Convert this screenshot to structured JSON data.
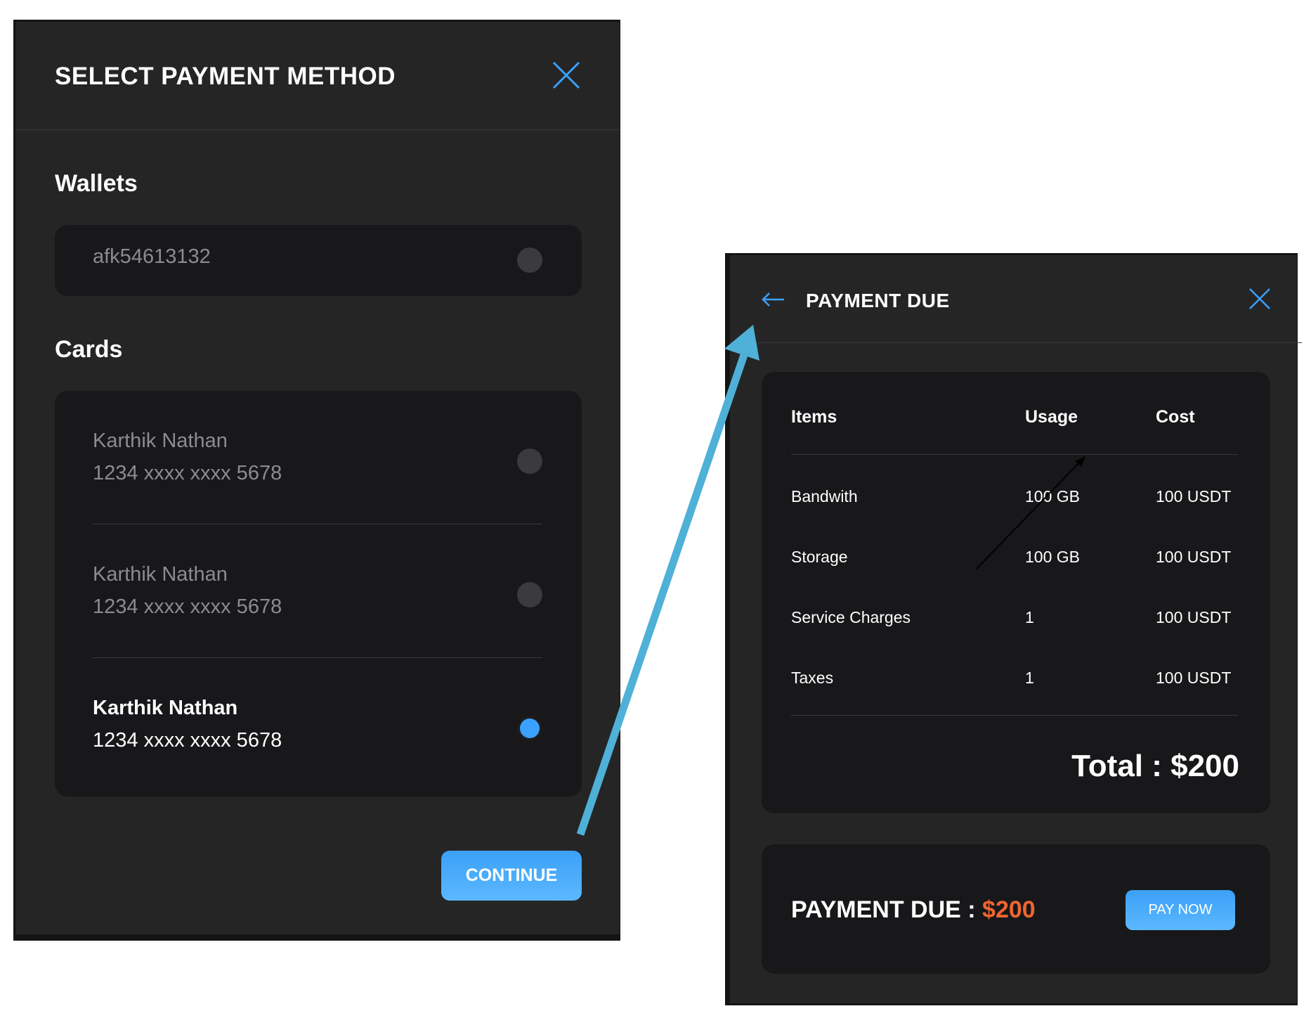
{
  "left": {
    "title": "SELECT PAYMENT METHOD",
    "wallets_heading": "Wallets",
    "wallet": {
      "id": "afk54613132",
      "selected": false
    },
    "cards_heading": "Cards",
    "cards": [
      {
        "name": "Karthik Nathan",
        "number": "1234 xxxx xxxx 5678",
        "selected": false
      },
      {
        "name": "Karthik Nathan",
        "number": "1234 xxxx xxxx 5678",
        "selected": false
      },
      {
        "name": "Karthik Nathan",
        "number": "1234 xxxx xxxx 5678",
        "selected": true
      }
    ],
    "continue_label": "CONTINUE"
  },
  "right": {
    "title": "PAYMENT DUE",
    "columns": [
      "Items",
      "Usage",
      "Cost"
    ],
    "rows": [
      {
        "item": "Bandwith",
        "usage": "100 GB",
        "cost": "100 USDT"
      },
      {
        "item": "Storage",
        "usage": "100 GB",
        "cost": "100 USDT"
      },
      {
        "item": "Service Charges",
        "usage": "1",
        "cost": "100 USDT"
      },
      {
        "item": "Taxes",
        "usage": "1",
        "cost": "100 USDT"
      }
    ],
    "total": "Total : $200",
    "due_label": "PAYMENT DUE : ",
    "due_amount": "$200",
    "pay_label": "PAY NOW"
  },
  "colors": {
    "accent": "#3aa1ff",
    "due_amount": "#ef6530",
    "annotation_arrow": "#4fb0d8"
  },
  "icons": [
    "close-icon",
    "back-arrow-icon",
    "radio-button"
  ]
}
